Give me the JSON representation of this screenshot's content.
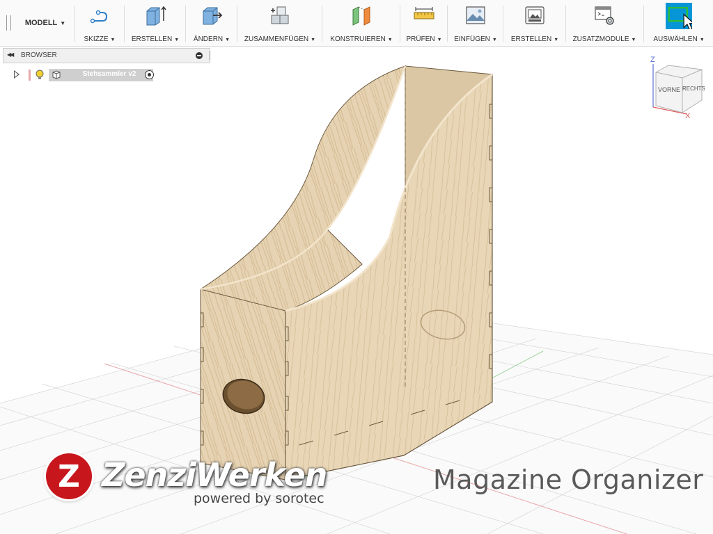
{
  "toolbar": {
    "workspace": {
      "label": "MODELL"
    },
    "groups": [
      {
        "label": "SKIZZE"
      },
      {
        "label": "ERSTELLEN"
      },
      {
        "label": "ÄNDERN"
      },
      {
        "label": "ZUSAMMENFÜGEN"
      },
      {
        "label": "KONSTRUIEREN"
      },
      {
        "label": "PRÜFEN"
      },
      {
        "label": "EINFÜGEN"
      },
      {
        "label": "ERSTELLEN"
      },
      {
        "label": "ZUSATZMODULE"
      },
      {
        "label": "AUSWÄHLEN"
      }
    ]
  },
  "browser": {
    "title": "BROWSER",
    "component": {
      "name": "Stehsammler v2"
    }
  },
  "viewcube": {
    "front": "VORNE",
    "right": "RECHTS",
    "axis_z": "Z",
    "axis_x": "X"
  },
  "overlay": {
    "brand": "ZenziWerken",
    "brand_initial": "Z",
    "powered": "powered by sorotec",
    "project_title": "Magazine Organizer"
  },
  "colors": {
    "accent": "#0696d7",
    "logo_red": "#c8161d",
    "wood": "#e3cfae"
  }
}
